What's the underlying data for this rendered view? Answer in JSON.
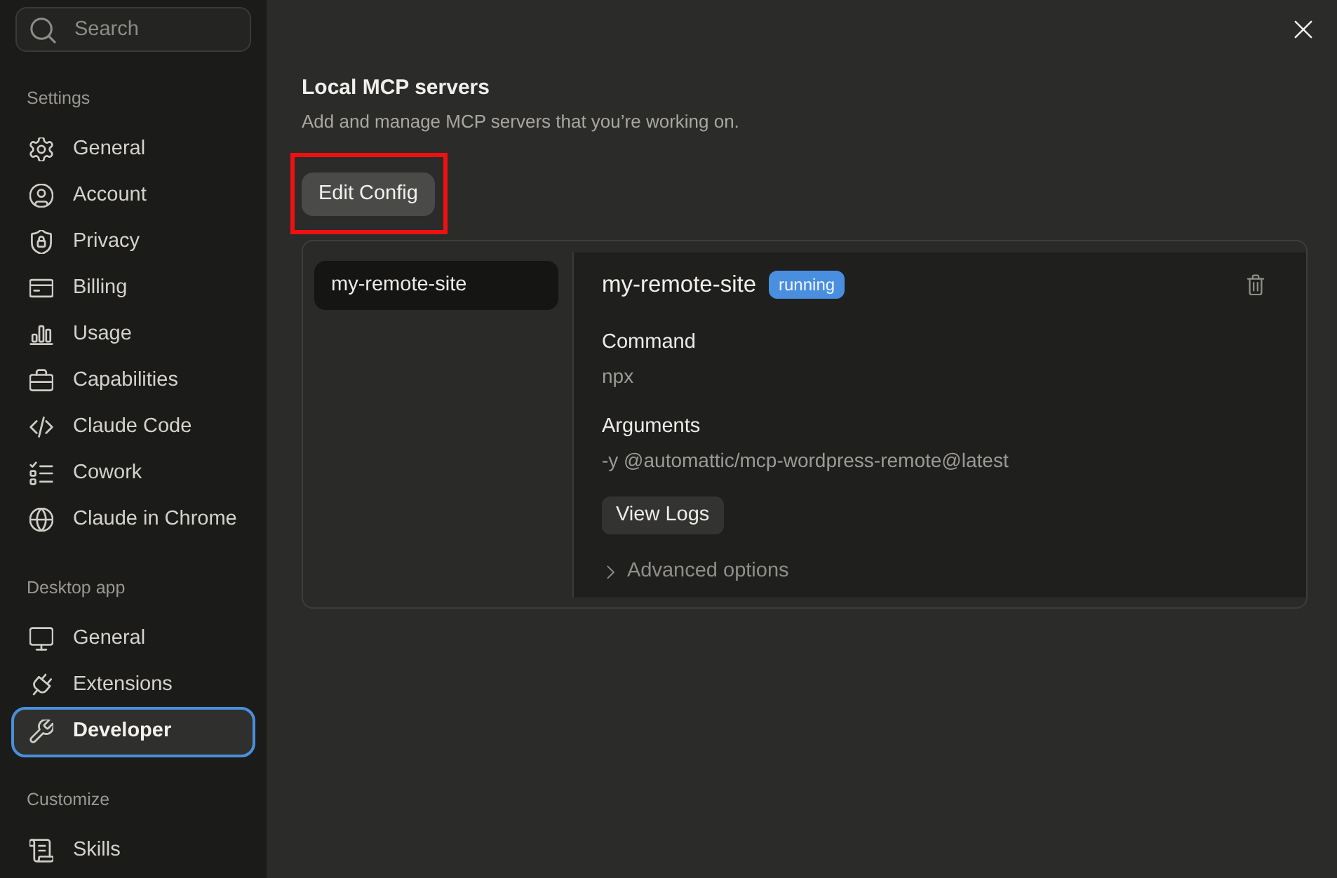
{
  "search": {
    "placeholder": "Search"
  },
  "sidebar": {
    "sections": [
      {
        "title": "Settings",
        "items": [
          {
            "label": "General",
            "selected": false
          },
          {
            "label": "Account",
            "selected": false
          },
          {
            "label": "Privacy",
            "selected": false
          },
          {
            "label": "Billing",
            "selected": false
          },
          {
            "label": "Usage",
            "selected": false
          },
          {
            "label": "Capabilities",
            "selected": false
          },
          {
            "label": "Claude Code",
            "selected": false
          },
          {
            "label": "Cowork",
            "selected": false
          },
          {
            "label": "Claude in Chrome",
            "selected": false
          }
        ]
      },
      {
        "title": "Desktop app",
        "items": [
          {
            "label": "General",
            "selected": false
          },
          {
            "label": "Extensions",
            "selected": false
          },
          {
            "label": "Developer",
            "selected": true
          }
        ]
      },
      {
        "title": "Customize",
        "items": [
          {
            "label": "Skills",
            "selected": false
          }
        ]
      }
    ]
  },
  "page": {
    "title": "Local MCP servers",
    "description": "Add and manage MCP servers that you’re working on.",
    "edit_button": {
      "label": "Edit Config",
      "highlighted": true
    }
  },
  "servers": [
    {
      "name": "my-remote-site",
      "selected": true
    }
  ],
  "detail": {
    "name": "my-remote-site",
    "status": "running",
    "fields": [
      {
        "label": "Command",
        "value": "npx"
      },
      {
        "label": "Arguments",
        "value": "-y @automattic/mcp-wordpress-remote@latest"
      }
    ],
    "logs_button": "View Logs",
    "advanced": {
      "label": "Advanced options",
      "expanded": false
    }
  }
}
